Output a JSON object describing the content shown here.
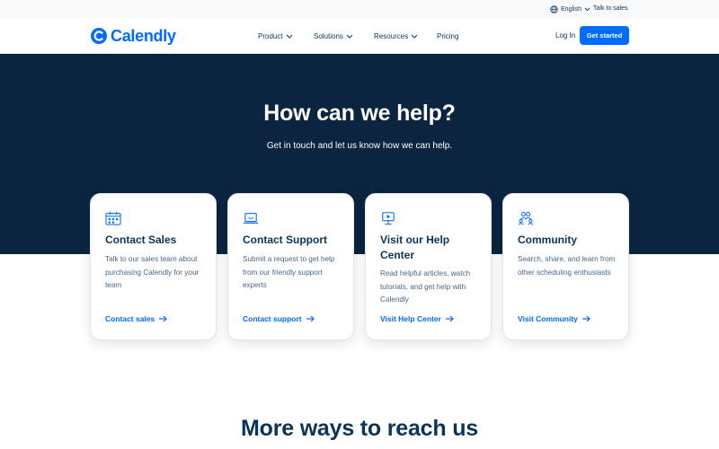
{
  "colors": {
    "brand_blue": "#006bff",
    "navy": "#0b2540",
    "text_dark": "#0b3558",
    "text_muted": "#476788"
  },
  "utility_bar": {
    "language": "English",
    "language_icon": "globe-icon",
    "talk_to_sales": "Talk to sales"
  },
  "header": {
    "logo_text": "Calendly",
    "nav": [
      {
        "label": "Product"
      },
      {
        "label": "Solutions"
      },
      {
        "label": "Resources"
      },
      {
        "label": "Pricing"
      }
    ],
    "login": "Log In",
    "cta": "Get started"
  },
  "hero": {
    "title": "How can we help?",
    "subtitle": "Get in touch and let us know how we can help."
  },
  "cards": [
    {
      "icon": "calendar-grid-icon",
      "title": "Contact Sales",
      "description": "Talk to our sales team about purchasing Calendly for your team",
      "link": "Contact sales"
    },
    {
      "icon": "laptop-icon",
      "title": "Contact Support",
      "description": "Submit a request to get help from our friendly support experts",
      "link": "Contact support"
    },
    {
      "icon": "presentation-board-icon",
      "title": "Visit our Help Center",
      "description": "Read helpful articles, watch tutorials, and get help with Calendly",
      "link": "Visit Help Center"
    },
    {
      "icon": "community-people-icon",
      "title": "Community",
      "description": "Search, share, and learn from other scheduling enthusiasts",
      "link": "Visit Community"
    }
  ],
  "section": {
    "more_title": "More ways to reach us"
  }
}
